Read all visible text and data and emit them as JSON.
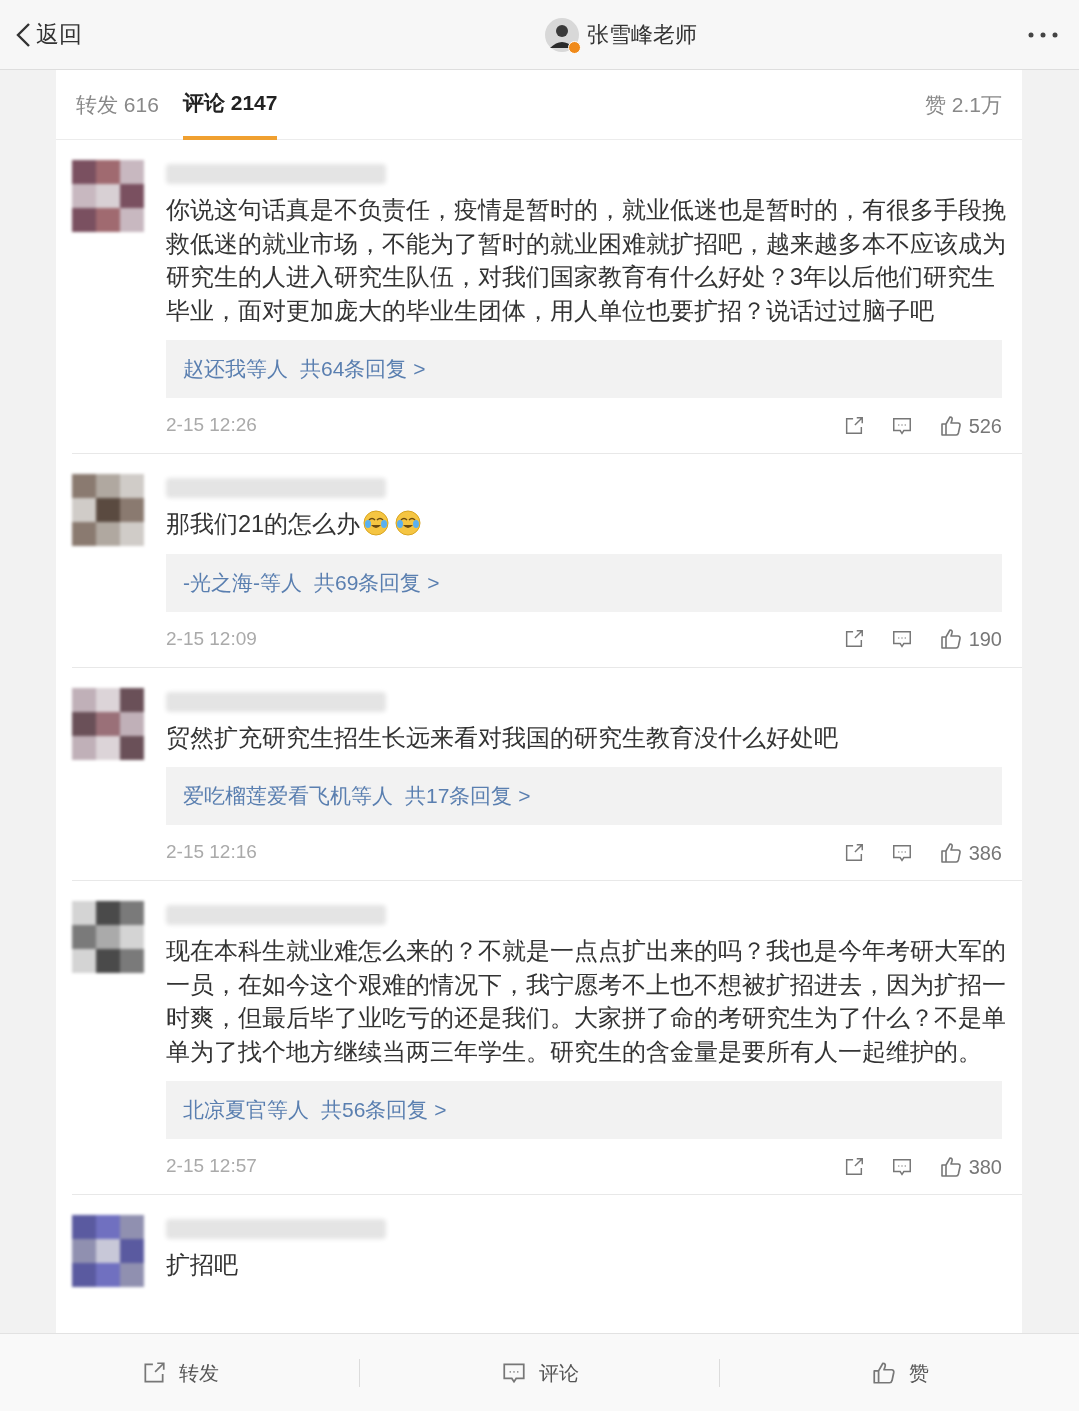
{
  "header": {
    "back_label": "返回",
    "title": "张雪峰老师"
  },
  "tabs": [
    {
      "label": "转发",
      "count": "616",
      "selected": false
    },
    {
      "label": "评论",
      "count": "2147",
      "selected": true
    }
  ],
  "likes": {
    "label": "赞",
    "count": "2.1万"
  },
  "comments": [
    {
      "content": [
        {
          "kind": "text",
          "text": "你说这句话真是不负责任，疫情是暂时的，就业低迷也是暂时的，有很多手段挽救低迷的就业市场，不能为了暂时的就业困难就扩招吧，越来越多本不应该成为研究生的人进入研究生队伍，对我们国家教育有什么好处？3年以后他们研究生毕业，面对更加庞大的毕业生团体，用人单位也要扩招？说话过过脑子吧"
        }
      ],
      "replies": {
        "names": "赵还我等人",
        "count": "共64条回复 >"
      },
      "time": "2-15 12:26",
      "likes": "526"
    },
    {
      "content": [
        {
          "kind": "text",
          "text": "那我们21的怎么办"
        },
        {
          "kind": "emoji"
        },
        {
          "kind": "emoji"
        }
      ],
      "replies": {
        "names": "-光之海-等人",
        "count": "共69条回复 >"
      },
      "time": "2-15 12:09",
      "likes": "190"
    },
    {
      "content": [
        {
          "kind": "text",
          "text": "贸然扩充研究生招生长远来看对我国的研究生教育没什么好处吧"
        }
      ],
      "replies": {
        "names": "爱吃榴莲爱看飞机等人",
        "count": "共17条回复 >"
      },
      "time": "2-15 12:16",
      "likes": "386"
    },
    {
      "content": [
        {
          "kind": "text",
          "text": "现在本科生就业难怎么来的？不就是一点点扩出来的吗？我也是今年考研大军的一员，在如今这个艰难的情况下，我宁愿考不上也不想被扩招进去，因为扩招一时爽，但最后毕了业吃亏的还是我们。大家拼了命的考研究生为了什么？不是单单为了找个地方继续当两三年学生。研究生的含金量是要所有人一起维护的。"
        }
      ],
      "replies": {
        "names": "北凉夏官等人",
        "count": "共56条回复 >"
      },
      "time": "2-15 12:57",
      "likes": "380"
    },
    {
      "content": [
        {
          "kind": "text",
          "text": "扩招吧"
        }
      ]
    }
  ],
  "bottom_bar": [
    {
      "kind": "repost",
      "label": "转发"
    },
    {
      "kind": "comment",
      "label": "评论"
    },
    {
      "kind": "like",
      "label": "赞"
    }
  ]
}
